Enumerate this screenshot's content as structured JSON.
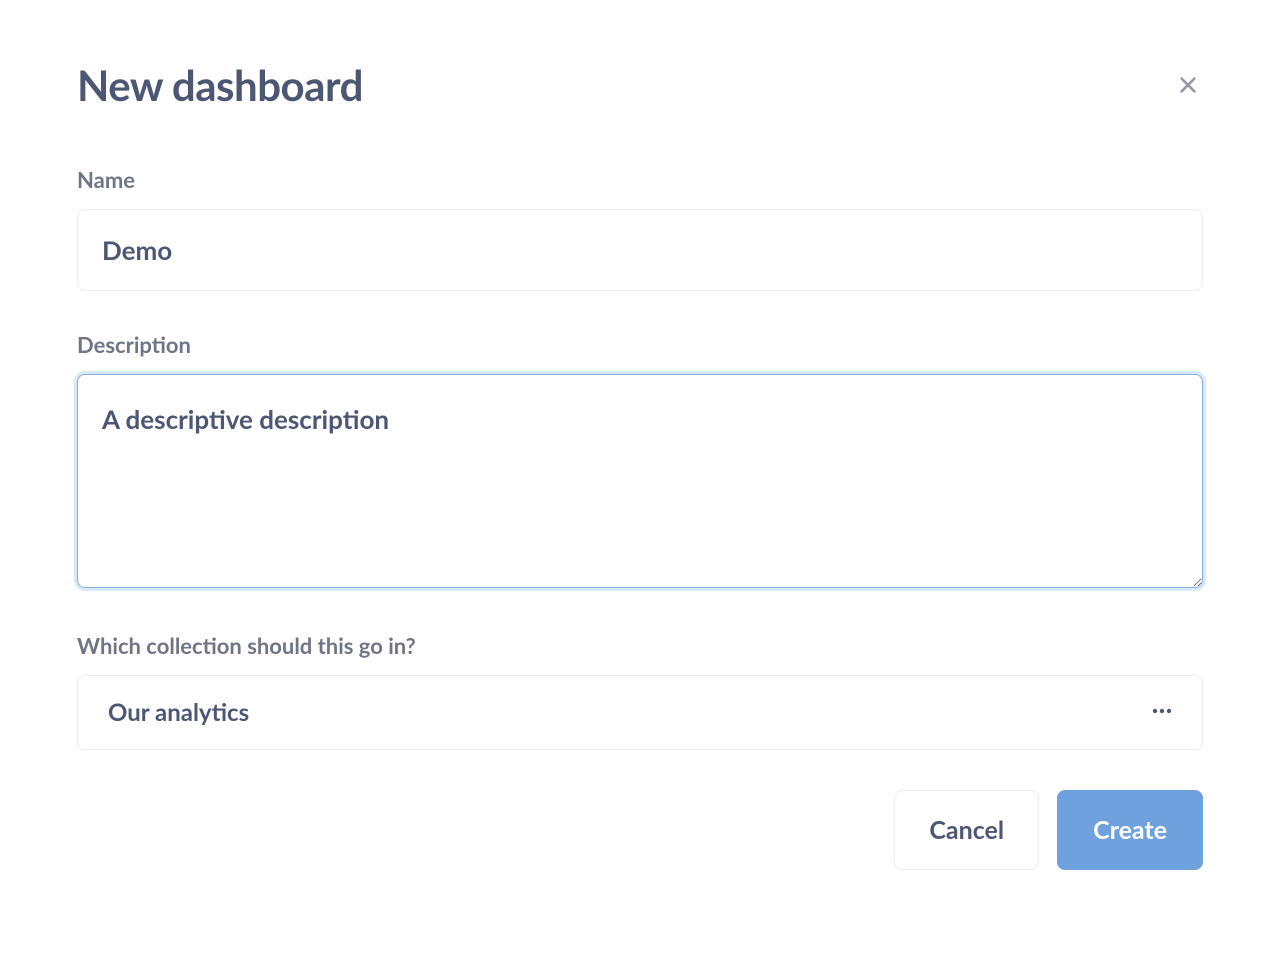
{
  "modal": {
    "title": "New dashboard",
    "close_aria": "Close"
  },
  "form": {
    "name": {
      "label": "Name",
      "value": "Demo"
    },
    "description": {
      "label": "Description",
      "value": "A descriptive description"
    },
    "collection": {
      "label": "Which collection should this go in?",
      "value": "Our analytics"
    }
  },
  "buttons": {
    "cancel": "Cancel",
    "create": "Create"
  }
}
